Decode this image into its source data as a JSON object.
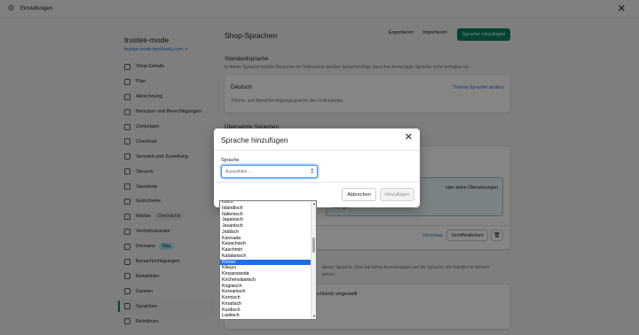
{
  "window": {
    "title": "Einstellungen",
    "close_icon": "close-icon"
  },
  "sidebar": {
    "store_name": "trustee-mode",
    "store_url": "trustee-mode.myshopify.com",
    "items": [
      {
        "label": "Shop-Details",
        "icon": "store-icon"
      },
      {
        "label": "Plan",
        "icon": "plan-icon"
      },
      {
        "label": "Abrechnung",
        "icon": "billing-icon"
      },
      {
        "label": "Benutzer und Berechtigungen",
        "icon": "users-icon"
      },
      {
        "label": "Zahlungen",
        "icon": "payments-icon"
      },
      {
        "label": "Checkout",
        "icon": "checkout-icon"
      },
      {
        "label": "Versand und Zustellung",
        "icon": "shipping-icon"
      },
      {
        "label": "Steuern",
        "icon": "taxes-icon"
      },
      {
        "label": "Standorte",
        "icon": "location-icon"
      },
      {
        "label": "Gutscheine",
        "icon": "gift-card-icon"
      },
      {
        "label": "Märkte",
        "icon": "markets-icon",
        "badge": "Demnächst"
      },
      {
        "label": "Vertriebskanäle",
        "icon": "channels-icon"
      },
      {
        "label": "Domains",
        "icon": "domains-icon",
        "badge": "Neu"
      },
      {
        "label": "Benachrichtigungen",
        "icon": "notifications-icon"
      },
      {
        "label": "Metafelder",
        "icon": "metafields-icon"
      },
      {
        "label": "Dateien",
        "icon": "files-icon"
      },
      {
        "label": "Sprachen",
        "icon": "languages-icon",
        "active": true
      },
      {
        "label": "Richtlinien",
        "icon": "policies-icon"
      }
    ]
  },
  "main": {
    "title": "Shop-Sprachen",
    "export_label": "Exportieren",
    "import_label": "Importieren",
    "add_language_label": "Sprache hinzufügen",
    "standard_title": "Standardsprache",
    "standard_desc": "In dieser Sprache werden Besucher im Onlineshop darüber benachrichtigt, dass ihre bevorzugte Sprache nicht verfügbar ist.",
    "default_language": "Deutsch",
    "change_theme_language": "Thema-Sprache ändern",
    "default_language_desc": "Theme- und Benachrichtigungssprache des Onlineshops.",
    "translated_title": "Übersetzte Sprachen",
    "banner_fragment_1": "oder deine Übersetzungen",
    "banner_fragment_2": "anzeigen",
    "preview_label": "Vorschau",
    "publish_label": "Veröffentlichen",
    "lower_desc_fragment": "dieser Sprache. Dies hat keine Auswirkungen auf die Sprache, die Kunden in deinem",
    "lower_desc_fragment_2": "sehen.",
    "lower_row_fragment": "(Deutschland) eingestellt"
  },
  "modal": {
    "title": "Sprache hinzufügen",
    "field_label": "Sprache",
    "select_value": "Auswählen ...",
    "cancel_label": "Abbrechen",
    "add_label": "Hinzufügen"
  },
  "dropdown": {
    "options": [
      "Irisch",
      "Isländisch",
      "Italienisch",
      "Japanisch",
      "Javanisch",
      "Jiddisch",
      "Kannada",
      "Kasachisch",
      "Kaschmiri",
      "Katalanisch",
      "Khmer",
      "Kikuyu",
      "Kinyarwanda",
      "Kirchenslawisch",
      "Kirgisisch",
      "Koreanisch",
      "Kornisch",
      "Kroatisch",
      "Kurdisch",
      "Laotisch"
    ],
    "selected": "Khmer"
  }
}
